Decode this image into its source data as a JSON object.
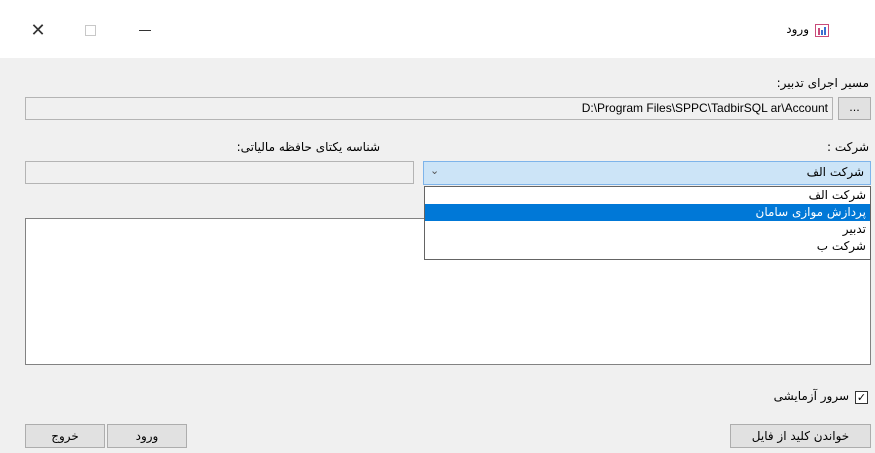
{
  "window": {
    "title": "ورود",
    "controls": {
      "close": "✕",
      "maximize": "",
      "minimize": ""
    }
  },
  "path_section": {
    "label": "مسیر اجرای تدبیر:",
    "value": "D:\\Program Files\\SPPC\\TadbirSQL ar\\Account",
    "browse_label": "..."
  },
  "company_section": {
    "label": "شرکت :",
    "selected": "شرکت الف",
    "arrow": "⌄",
    "options": [
      "شرکت الف",
      "پردازش موازی سامان",
      "تدبیر",
      "شرکت ب"
    ],
    "highlighted_index": 1
  },
  "tax_section": {
    "label": "شناسه یکتای حافظه مالیاتی:",
    "value": ""
  },
  "test_server": {
    "label": "سرور آزمایشی",
    "checked": true,
    "mark": "✓"
  },
  "buttons": {
    "read_key": "خواندن کلید از فایل",
    "login": "ورود",
    "exit": "خروج"
  }
}
